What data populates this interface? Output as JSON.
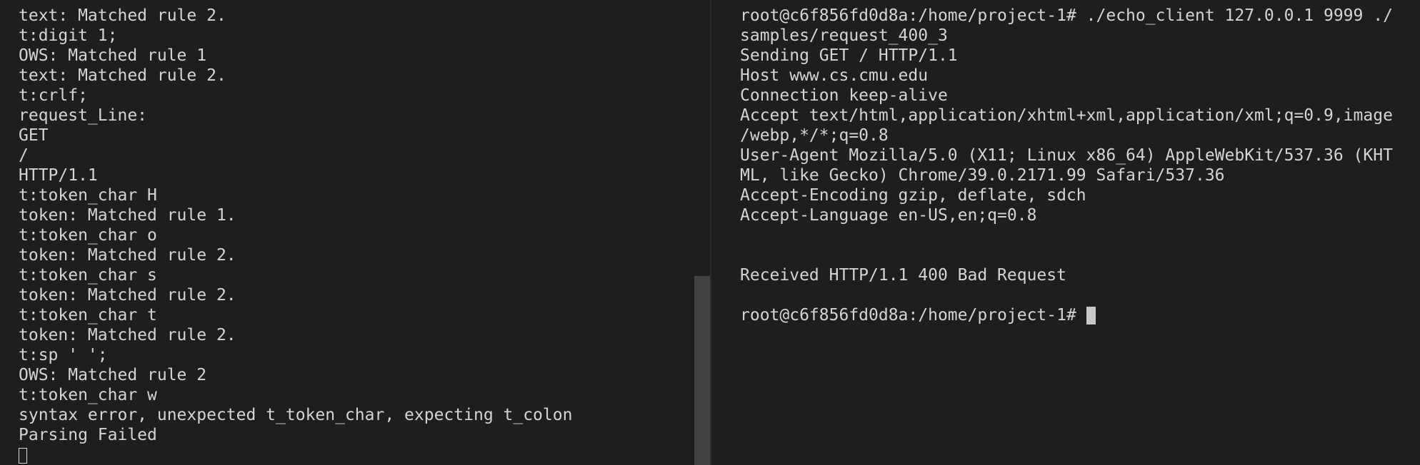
{
  "left_terminal": {
    "lines": [
      "text: Matched rule 2.",
      "t:digit 1;",
      "OWS: Matched rule 1",
      "text: Matched rule 2.",
      "t:crlf;",
      "request_Line:",
      "GET",
      "/",
      "HTTP/1.1",
      "t:token_char H",
      "token: Matched rule 1.",
      "t:token_char o",
      "token: Matched rule 2.",
      "t:token_char s",
      "token: Matched rule 2.",
      "t:token_char t",
      "token: Matched rule 2.",
      "t:sp ' ';",
      "OWS: Matched rule 2",
      "t:token_char w",
      "syntax error, unexpected t_token_char, expecting t_colon",
      "Parsing Failed"
    ]
  },
  "right_terminal": {
    "lines": [
      "root@c6f856fd0d8a:/home/project-1# ./echo_client 127.0.0.1 9999 ./",
      "samples/request_400_3",
      "Sending GET / HTTP/1.1",
      "Host www.cs.cmu.edu",
      "Connection keep-alive",
      "Accept text/html,application/xhtml+xml,application/xml;q=0.9,image",
      "/webp,*/*;q=0.8",
      "User-Agent Mozilla/5.0 (X11; Linux x86_64) AppleWebKit/537.36 (KHT",
      "ML, like Gecko) Chrome/39.0.2171.99 Safari/537.36",
      "Accept-Encoding gzip, deflate, sdch",
      "Accept-Language en-US,en;q=0.8",
      "",
      "",
      "Received HTTP/1.1 400 Bad Request",
      ""
    ],
    "prompt": "root@c6f856fd0d8a:/home/project-1#"
  },
  "colors": {
    "background": "#1e1e1e",
    "text": "#d4d4d4",
    "scrollbar_thumb": "#424242",
    "cursor": "#c8c8c8"
  }
}
